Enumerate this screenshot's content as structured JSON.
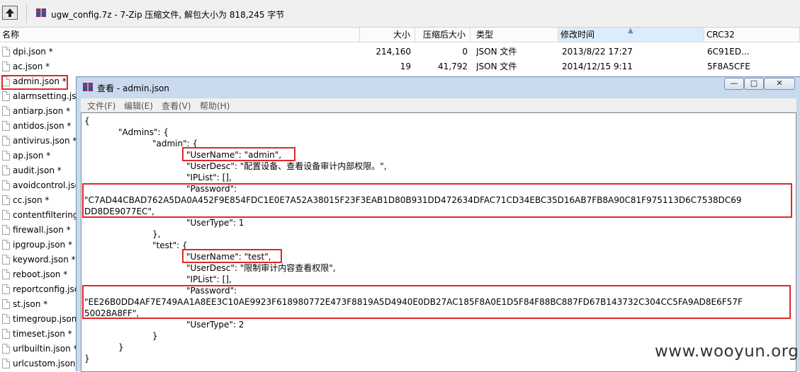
{
  "window": {
    "address": "ugw_config.7z - 7-Zip 压缩文件, 解包大小为 818,245 字节"
  },
  "columns": {
    "name": "名称",
    "size": "大小",
    "packed": "压缩后大小",
    "type": "类型",
    "modified": "修改时间",
    "crc": "CRC32"
  },
  "files": [
    {
      "name": "dpi.json *",
      "size": "214,160",
      "packed": "0",
      "type": "JSON 文件",
      "modified": "2013/8/22 17:27",
      "crc": "6C91ED..."
    },
    {
      "name": "ac.json *",
      "size": "19",
      "packed": "41,792",
      "type": "JSON 文件",
      "modified": "2014/12/15 9:11",
      "crc": "5F8A5CFE"
    },
    {
      "name": "admin.json *"
    },
    {
      "name": "alarmsetting.json"
    },
    {
      "name": "antiarp.json *"
    },
    {
      "name": "antidos.json *"
    },
    {
      "name": "antivirus.json *"
    },
    {
      "name": "ap.json *"
    },
    {
      "name": "audit.json *"
    },
    {
      "name": "avoidcontrol.json"
    },
    {
      "name": "cc.json *"
    },
    {
      "name": "contentfiltering.json"
    },
    {
      "name": "firewall.json *"
    },
    {
      "name": "ipgroup.json *"
    },
    {
      "name": "keyword.json *"
    },
    {
      "name": "reboot.json *"
    },
    {
      "name": "reportconfig.json"
    },
    {
      "name": "st.json *"
    },
    {
      "name": "timegroup.json"
    },
    {
      "name": "timeset.json *"
    },
    {
      "name": "urlbuiltin.json *"
    },
    {
      "name": "urlcustom.json"
    }
  ],
  "viewer": {
    "title": "查看 - admin.json",
    "buttons": {
      "minimize": "—",
      "maximize": "□",
      "close": "✕"
    },
    "menu": [
      "文件(F)",
      "编辑(E)",
      "查看(V)",
      "帮助(H)"
    ],
    "lines": [
      "{",
      "\"Admins\": {",
      "\"admin\": {",
      "\"UserName\": \"admin\",",
      "\"UserDesc\": \"配置设备、查看设备审计内部权限。\",",
      "\"IPList\": [],",
      "\"Password\":",
      "\"C7AD44CBAD762A5DA0A452F9E854FDC1E0E7A52A38015F23F3EAB1D80B931DD472634DFAC71CD34EBC35D16AB7FB8A90C81F975113D6C7538DC69",
      "DD8DE9077EC\",",
      "\"UserType\": 1",
      "},",
      "\"test\": {",
      "\"UserName\": \"test\",",
      "\"UserDesc\": \"限制审计内容查看权限\",",
      "\"IPList\": [],",
      "\"Password\":",
      "\"EE26B0DD4AF7E749AA1A8EE3C10AE9923F618980772E473F8819A5D4940E0DB27AC185F8A0E1D5F84F88BC887FD67B143732C304CC5FA9AD8E6F57F",
      "50028A8FF\",",
      "\"UserType\": 2",
      "}",
      "}",
      "}"
    ]
  },
  "watermark": "www.wooyun.org",
  "colors": {
    "highlight": "#e0272a",
    "titlebar": "#c9d9ee"
  }
}
